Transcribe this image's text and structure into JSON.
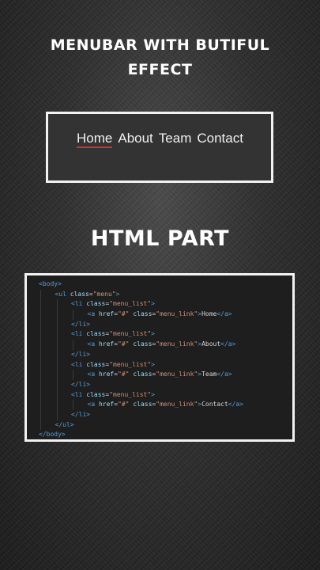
{
  "title": {
    "line1": "MENUBAR WITH BUTIFUL",
    "line2": "EFFECT"
  },
  "demo_menu": {
    "items": [
      "Home",
      "About",
      "Team",
      "Contact"
    ],
    "active_index": 0,
    "underline_color": "#cc3333"
  },
  "section_title": "HTML PART",
  "code": {
    "lines": [
      {
        "indent": 0,
        "tokens": [
          [
            "tag",
            "<body>"
          ]
        ]
      },
      {
        "indent": 1,
        "tokens": [
          [
            "tag",
            "<ul "
          ],
          [
            "attr",
            "class"
          ],
          [
            "txt",
            "="
          ],
          [
            "str",
            "\"menu\""
          ],
          [
            "tag",
            ">"
          ]
        ]
      },
      {
        "indent": 2,
        "tokens": [
          [
            "tag",
            "<li "
          ],
          [
            "attr",
            "class"
          ],
          [
            "txt",
            "="
          ],
          [
            "str",
            "\"menu_list\""
          ],
          [
            "tag",
            ">"
          ]
        ]
      },
      {
        "indent": 3,
        "tokens": [
          [
            "tag",
            "<a "
          ],
          [
            "attr",
            "href"
          ],
          [
            "txt",
            "="
          ],
          [
            "str",
            "\"#\""
          ],
          [
            "txt",
            " "
          ],
          [
            "attr",
            "class"
          ],
          [
            "txt",
            "="
          ],
          [
            "str",
            "\"menu_link\""
          ],
          [
            "tag",
            ">"
          ],
          [
            "txt",
            "Home"
          ],
          [
            "tag",
            "</a>"
          ]
        ]
      },
      {
        "indent": 2,
        "tokens": [
          [
            "tag",
            "</li>"
          ]
        ]
      },
      {
        "indent": 2,
        "tokens": [
          [
            "tag",
            "<li "
          ],
          [
            "attr",
            "class"
          ],
          [
            "txt",
            "="
          ],
          [
            "str",
            "\"menu_list\""
          ],
          [
            "tag",
            ">"
          ]
        ]
      },
      {
        "indent": 3,
        "tokens": [
          [
            "tag",
            "<a "
          ],
          [
            "attr",
            "href"
          ],
          [
            "txt",
            "="
          ],
          [
            "str",
            "\"#\""
          ],
          [
            "txt",
            " "
          ],
          [
            "attr",
            "class"
          ],
          [
            "txt",
            "="
          ],
          [
            "str",
            "\"menu_link\""
          ],
          [
            "tag",
            ">"
          ],
          [
            "txt",
            "About"
          ],
          [
            "tag",
            "</a>"
          ]
        ]
      },
      {
        "indent": 2,
        "tokens": [
          [
            "tag",
            "</li>"
          ]
        ]
      },
      {
        "indent": 2,
        "tokens": [
          [
            "tag",
            "<li "
          ],
          [
            "attr",
            "class"
          ],
          [
            "txt",
            "="
          ],
          [
            "str",
            "\"menu_list\""
          ],
          [
            "tag",
            ">"
          ]
        ]
      },
      {
        "indent": 3,
        "tokens": [
          [
            "tag",
            "<a "
          ],
          [
            "attr",
            "href"
          ],
          [
            "txt",
            "="
          ],
          [
            "str",
            "\"#\""
          ],
          [
            "txt",
            " "
          ],
          [
            "attr",
            "class"
          ],
          [
            "txt",
            "="
          ],
          [
            "str",
            "\"menu_link\""
          ],
          [
            "tag",
            ">"
          ],
          [
            "txt",
            "Team"
          ],
          [
            "tag",
            "</a>"
          ]
        ]
      },
      {
        "indent": 2,
        "tokens": [
          [
            "tag",
            "</li>"
          ]
        ]
      },
      {
        "indent": 2,
        "tokens": [
          [
            "tag",
            "<li "
          ],
          [
            "attr",
            "class"
          ],
          [
            "txt",
            "="
          ],
          [
            "str",
            "\"menu_list\""
          ],
          [
            "tag",
            ">"
          ]
        ]
      },
      {
        "indent": 3,
        "tokens": [
          [
            "tag",
            "<a "
          ],
          [
            "attr",
            "href"
          ],
          [
            "txt",
            "="
          ],
          [
            "str",
            "\"#\""
          ],
          [
            "txt",
            " "
          ],
          [
            "attr",
            "class"
          ],
          [
            "txt",
            "="
          ],
          [
            "str",
            "\"menu_link\""
          ],
          [
            "tag",
            ">"
          ],
          [
            "txt",
            "Contact"
          ],
          [
            "tag",
            "</a>"
          ]
        ]
      },
      {
        "indent": 2,
        "tokens": [
          [
            "tag",
            "</li>"
          ]
        ]
      },
      {
        "indent": 1,
        "tokens": [
          [
            "tag",
            "</ul>"
          ]
        ]
      },
      {
        "indent": 0,
        "tokens": [
          [
            "tag",
            "</body>"
          ]
        ]
      }
    ]
  }
}
